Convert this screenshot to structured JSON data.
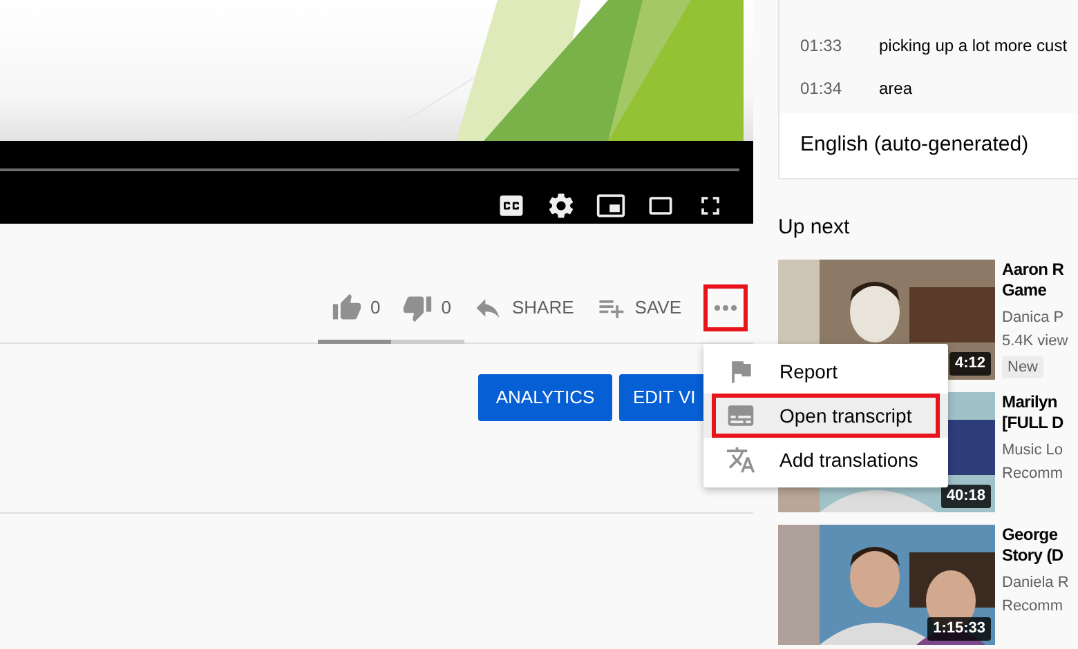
{
  "player": {
    "controls": [
      {
        "kind": "captions"
      },
      {
        "kind": "settings"
      },
      {
        "kind": "miniplayer"
      },
      {
        "kind": "theater"
      },
      {
        "kind": "fullscreen"
      }
    ]
  },
  "actions": [
    {
      "kind": "like",
      "label": "0"
    },
    {
      "kind": "dislike",
      "label": "0"
    },
    {
      "kind": "share",
      "label": "SHARE"
    },
    {
      "kind": "save",
      "label": "SAVE"
    }
  ],
  "sentiment_bar": {
    "level": 0.5
  },
  "more_button": {
    "outlined": true
  },
  "owner_buttons": [
    "ANALYTICS",
    "EDIT VI"
  ],
  "menu": [
    {
      "kind": "report",
      "label": "Report",
      "highlighted": false,
      "outlined": false
    },
    {
      "kind": "transcript",
      "label": "Open transcript",
      "highlighted": true,
      "outlined": true
    },
    {
      "kind": "translate",
      "label": "Add translations",
      "highlighted": false,
      "outlined": false
    }
  ],
  "transcript": {
    "rows": [
      {
        "time": "01:33",
        "text": "picking up a lot more cust"
      },
      {
        "time": "01:34",
        "text": "area"
      }
    ],
    "language": "English (auto-generated)"
  },
  "up_next": {
    "heading": "Up next",
    "videos": [
      {
        "kind": "picture",
        "duration": "4:12",
        "title_lines": [
          "Aaron R",
          "Game"
        ],
        "meta": [
          "Danica P",
          "5.4K view"
        ],
        "badge": "New"
      },
      {
        "kind": "picture",
        "duration": "40:18",
        "title_lines": [
          "Marilyn",
          "[FULL D"
        ],
        "meta": [
          "Music Lo",
          "Recomm"
        ]
      },
      {
        "kind": "picture",
        "duration": "1:15:33",
        "title_lines": [
          "George",
          "Story (D"
        ],
        "meta": [
          "Daniela R",
          "Recomm"
        ]
      }
    ]
  }
}
